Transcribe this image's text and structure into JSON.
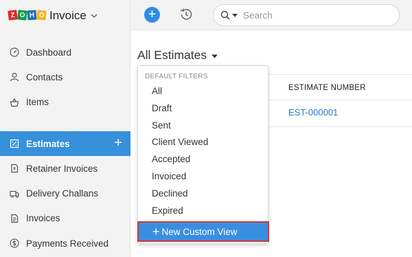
{
  "brand": {
    "logo_letters": [
      "Z",
      "O",
      "H",
      "O"
    ],
    "product": "Invoice"
  },
  "topbar": {
    "search_placeholder": "Search"
  },
  "sidebar": {
    "items": [
      {
        "label": "Dashboard",
        "icon": "dashboard-icon"
      },
      {
        "label": "Contacts",
        "icon": "contacts-icon"
      },
      {
        "label": "Items",
        "icon": "items-icon"
      },
      {
        "label": "Estimates",
        "icon": "estimates-icon",
        "active": true
      },
      {
        "label": "Retainer Invoices",
        "icon": "retainer-invoices-icon"
      },
      {
        "label": "Delivery Challans",
        "icon": "delivery-challans-icon"
      },
      {
        "label": "Invoices",
        "icon": "invoices-icon"
      },
      {
        "label": "Payments Received",
        "icon": "payments-received-icon"
      }
    ]
  },
  "main": {
    "title": "All Estimates",
    "column_header": "ESTIMATE NUMBER",
    "rows": [
      {
        "estimate_number": "EST-000001"
      }
    ]
  },
  "dropdown": {
    "header": "DEFAULT FILTERS",
    "options": [
      "All",
      "Draft",
      "Sent",
      "Client Viewed",
      "Accepted",
      "Invoiced",
      "Declined",
      "Expired"
    ],
    "new_view_label": "New Custom View"
  },
  "colors": {
    "accent": "#3790da",
    "link": "#2c7ac9",
    "highlight_border": "#d13a2d"
  }
}
